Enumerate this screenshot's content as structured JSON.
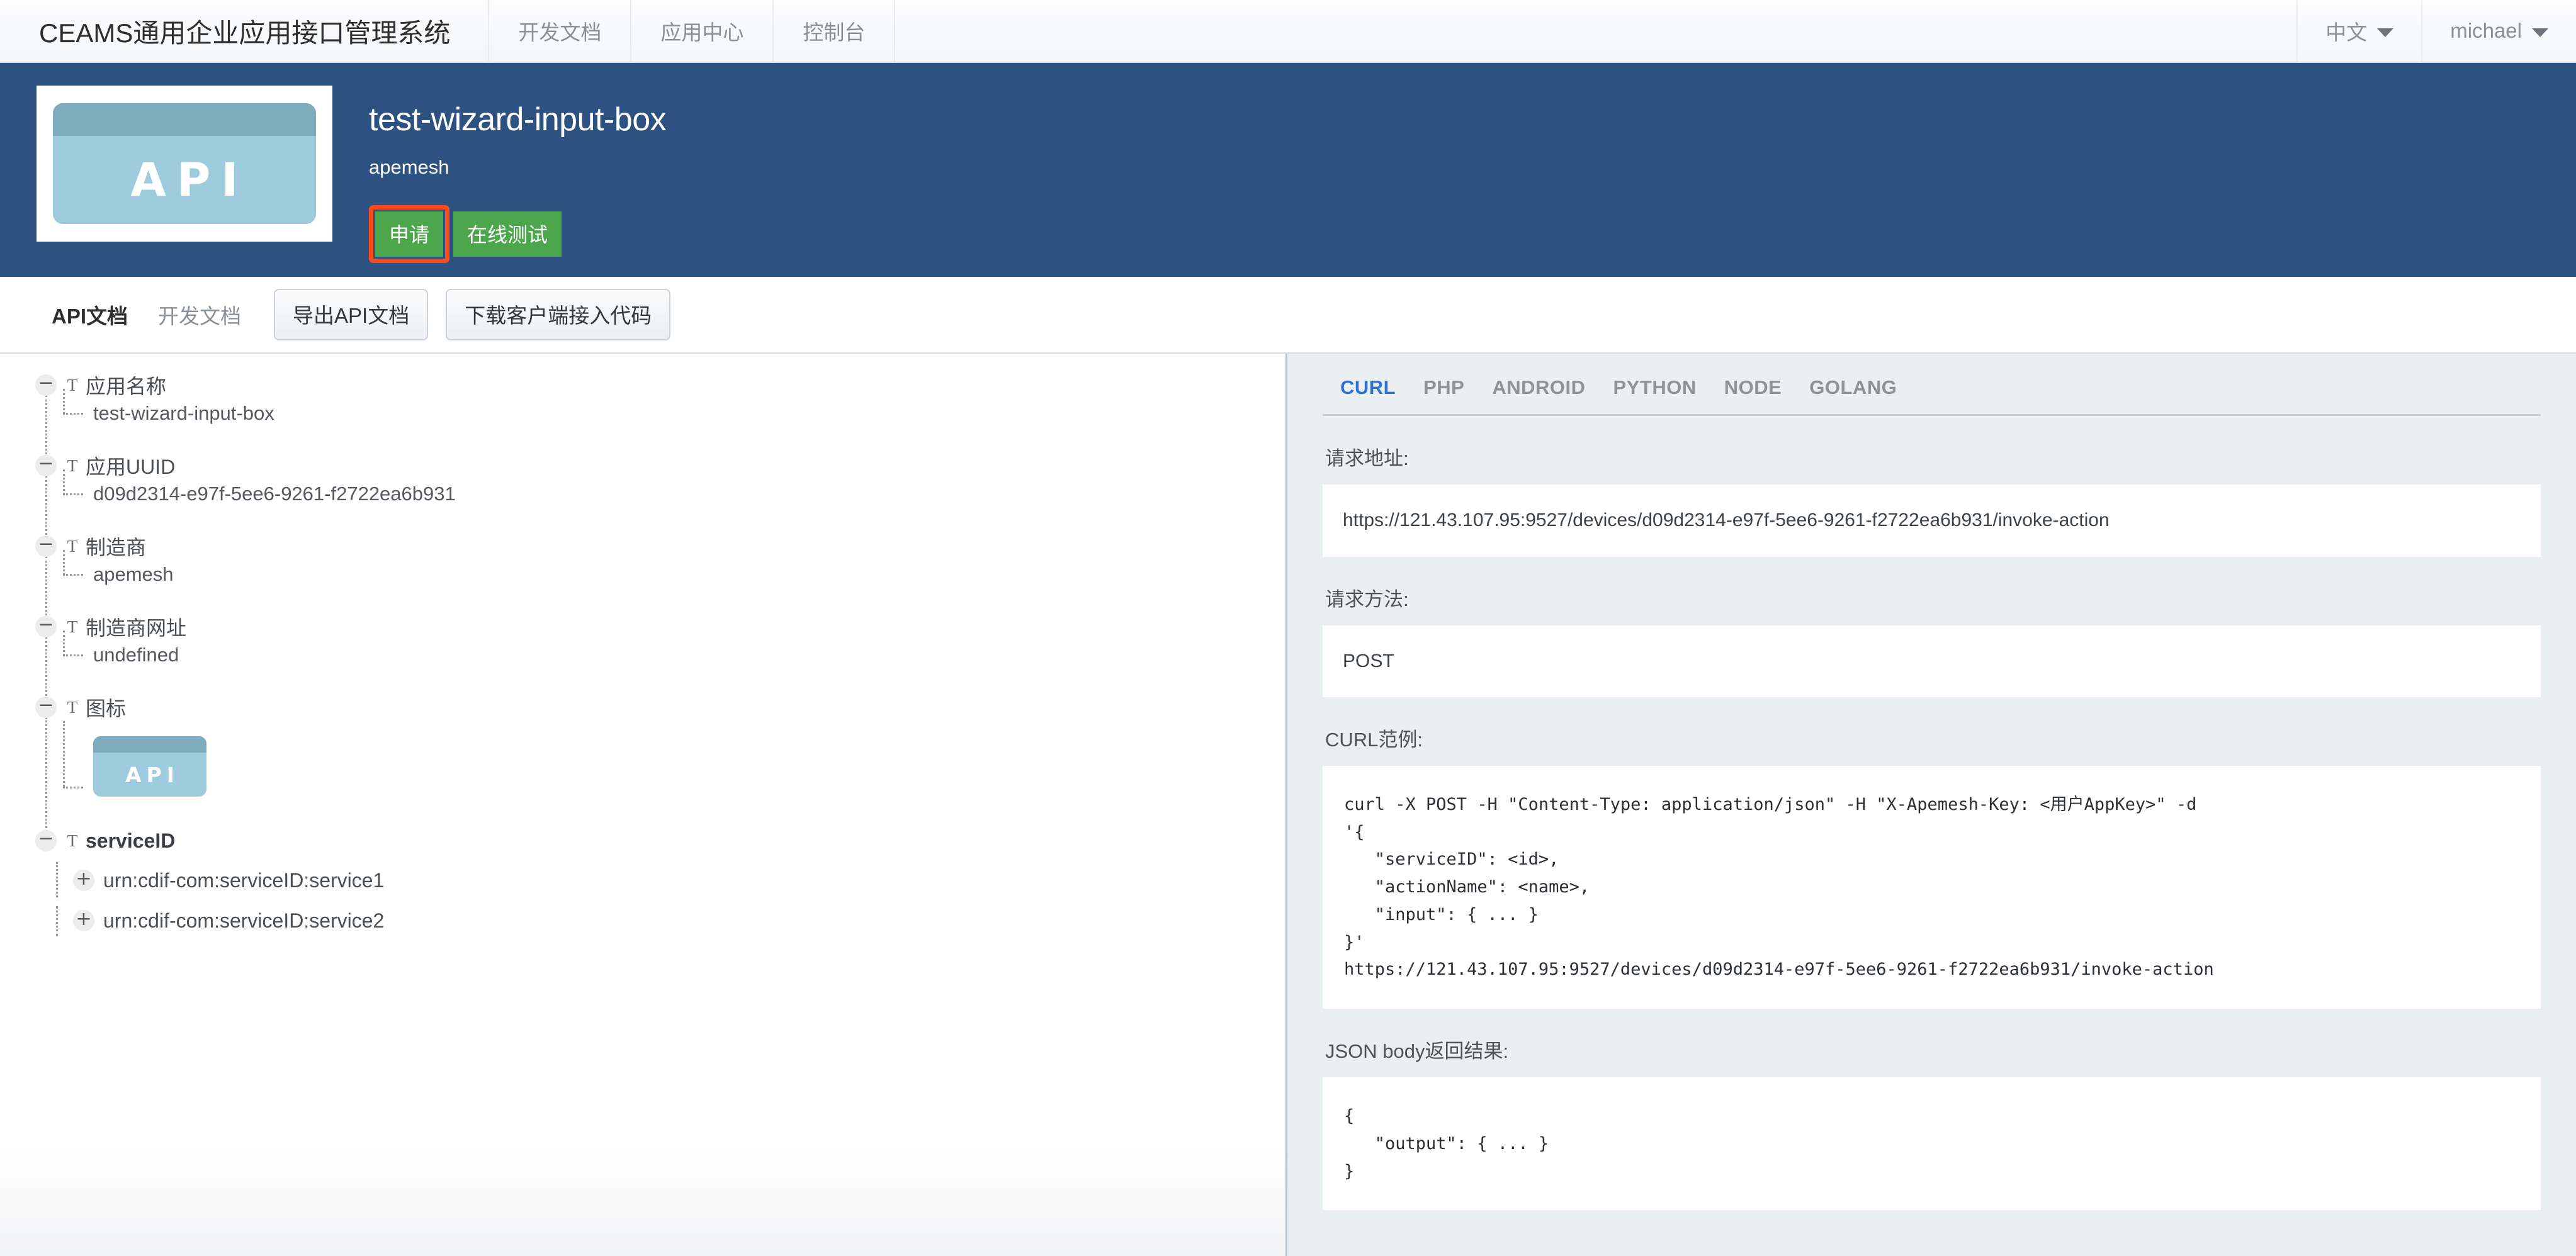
{
  "header": {
    "brand": "CEAMS通用企业应用接口管理系统",
    "nav": [
      {
        "label": "开发文档"
      },
      {
        "label": "应用中心"
      },
      {
        "label": "控制台"
      }
    ],
    "language": "中文",
    "user": "michael"
  },
  "banner": {
    "logo_text": "API",
    "title": "test-wizard-input-box",
    "vendor": "apemesh",
    "apply_button": "申请",
    "test_button": "在线测试",
    "highlight_color": "#fc4c1e",
    "background_color": "#2d5180",
    "button_color": "#4ca64c"
  },
  "docbar": {
    "tabs": [
      {
        "label": "API文档",
        "active": true
      },
      {
        "label": "开发文档",
        "active": false
      }
    ],
    "export_button": "导出API文档",
    "download_button": "下载客户端接入代码"
  },
  "tree": {
    "nodes": [
      {
        "toggle": "−",
        "type_icon": "T",
        "label": "应用名称",
        "child": "test-wizard-input-box"
      },
      {
        "toggle": "−",
        "type_icon": "T",
        "label": "应用UUID",
        "child": "d09d2314-e97f-5ee6-9261-f2722ea6b931"
      },
      {
        "toggle": "−",
        "type_icon": "T",
        "label": "制造商",
        "child": "apemesh"
      },
      {
        "toggle": "−",
        "type_icon": "T",
        "label": "制造商网址",
        "child": "undefined"
      },
      {
        "toggle": "−",
        "type_icon": "T",
        "label": "图标",
        "child": ""
      },
      {
        "toggle": "−",
        "type_icon": "T",
        "label": "serviceID",
        "child": ""
      }
    ],
    "icon_label": "API",
    "services": [
      {
        "toggle": "+",
        "label": "urn:cdif-com:serviceID:service1"
      },
      {
        "toggle": "+",
        "label": "urn:cdif-com:serviceID:service2"
      }
    ]
  },
  "codepanel": {
    "tabs": [
      {
        "label": "CURL",
        "active": true
      },
      {
        "label": "PHP",
        "active": false
      },
      {
        "label": "ANDROID",
        "active": false
      },
      {
        "label": "PYTHON",
        "active": false
      },
      {
        "label": "NODE",
        "active": false
      },
      {
        "label": "GOLANG",
        "active": false
      }
    ],
    "active_tab_color": "#2f72d6",
    "request_url_label": "请求地址:",
    "request_url": "https://121.43.107.95:9527/devices/d09d2314-e97f-5ee6-9261-f2722ea6b931/invoke-action",
    "request_method_label": "请求方法:",
    "request_method": "POST",
    "curl_example_label": "CURL范例:",
    "curl_example": "curl -X POST -H \"Content-Type: application/json\" -H \"X-Apemesh-Key: <用户AppKey>\" -d\n'{\n   \"serviceID\": <id>,\n   \"actionName\": <name>,\n   \"input\": { ... }\n}'\nhttps://121.43.107.95:9527/devices/d09d2314-e97f-5ee6-9261-f2722ea6b931/invoke-action",
    "json_body_label": "JSON body返回结果:",
    "json_body": "{\n   \"output\": { ... }\n}"
  }
}
